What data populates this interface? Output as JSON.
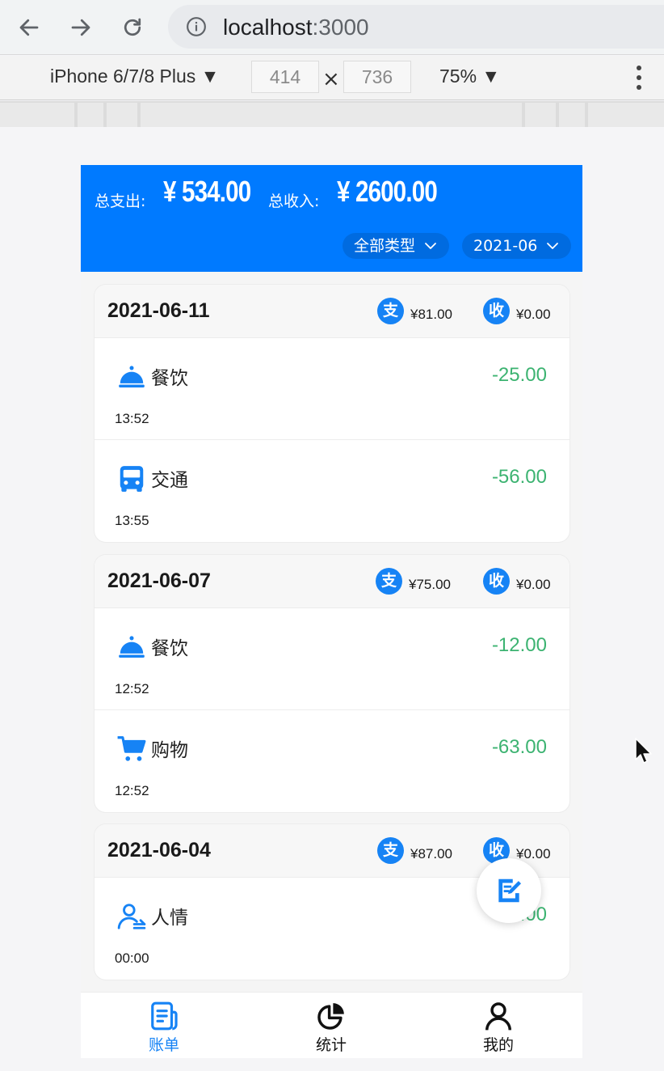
{
  "browser": {
    "url_host": "localhost",
    "url_port": ":3000",
    "back_icon": "arrow-left-icon",
    "forward_icon": "arrow-right-icon",
    "reload_icon": "reload-icon",
    "info_icon": "info-icon"
  },
  "devtools": {
    "device": "iPhone 6/7/8 Plus ▼",
    "width": "414",
    "height": "736",
    "times": "×",
    "zoom": "75% ▼"
  },
  "summary": {
    "expense_label": "总支出:",
    "expense_value": "¥ 534.00",
    "income_label": "总收入:",
    "income_value": "¥ 2600.00",
    "type_filter": "全部类型",
    "month_filter": "2021-06"
  },
  "days": [
    {
      "date": "2021-06-11",
      "expense_badge": "支",
      "expense": "¥81.00",
      "income_badge": "收",
      "income": "¥0.00",
      "items": [
        {
          "category": "餐饮",
          "icon": "food-cover-icon",
          "amount": "-25.00",
          "time": "13:52"
        },
        {
          "category": "交通",
          "icon": "bus-icon",
          "amount": "-56.00",
          "time": "13:55"
        }
      ]
    },
    {
      "date": "2021-06-07",
      "expense_badge": "支",
      "expense": "¥75.00",
      "income_badge": "收",
      "income": "¥0.00",
      "items": [
        {
          "category": "餐饮",
          "icon": "food-cover-icon",
          "amount": "-12.00",
          "time": "12:52"
        },
        {
          "category": "购物",
          "icon": "cart-icon",
          "amount": "-63.00",
          "time": "12:52"
        }
      ]
    },
    {
      "date": "2021-06-04",
      "expense_badge": "支",
      "expense": "¥87.00",
      "income_badge": "收",
      "income": "¥0.00",
      "items": [
        {
          "category": "人情",
          "icon": "person-gift-icon",
          "amount": "-87.00",
          "time": "00:00"
        }
      ]
    }
  ],
  "tabbar": {
    "bills": "账单",
    "stats": "统计",
    "mine": "我的"
  },
  "colors": {
    "brand": "#007aff",
    "badge": "#1683f5",
    "expense_amount": "#3cb371",
    "tab_active": "#1683f5"
  }
}
